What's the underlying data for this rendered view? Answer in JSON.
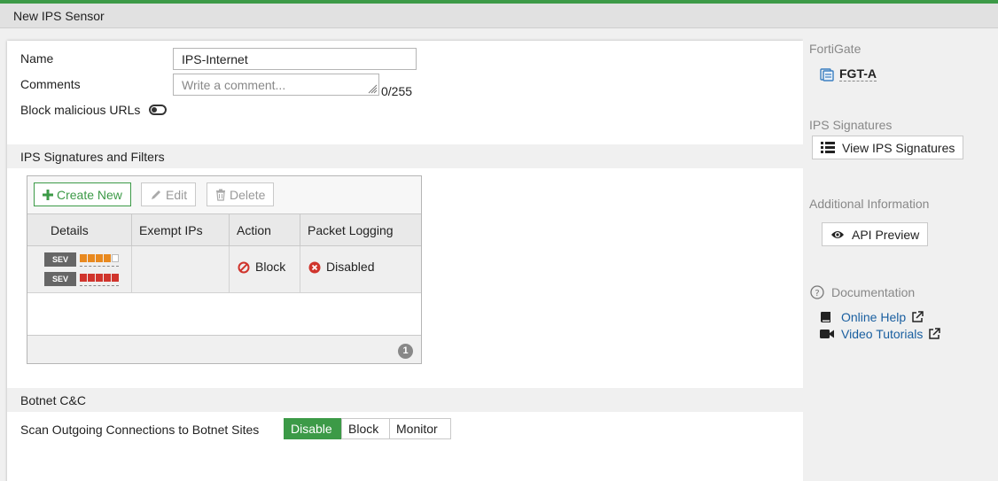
{
  "window": {
    "title": "New IPS Sensor"
  },
  "form": {
    "name_label": "Name",
    "name_value": "IPS-Internet",
    "comments_label": "Comments",
    "comments_placeholder": "Write a comment...",
    "comments_counter": "0/255",
    "block_urls_label": "Block malicious URLs"
  },
  "signatures": {
    "section_title": "IPS Signatures and Filters",
    "toolbar": {
      "create_label": "Create New",
      "edit_label": "Edit",
      "delete_label": "Delete"
    },
    "columns": [
      "Details",
      "Exempt IPs",
      "Action",
      "Packet Logging"
    ],
    "rows": [
      {
        "severity_badges": [
          "SEV",
          "SEV"
        ],
        "severity_levels": [
          4,
          5
        ],
        "exempt_ips": "",
        "action": "Block",
        "packet_logging": "Disabled"
      }
    ],
    "count": "1"
  },
  "botnet": {
    "section_title": "Botnet C&C",
    "scan_label": "Scan Outgoing Connections to Botnet Sites",
    "options": [
      "Disable",
      "Block",
      "Monitor"
    ],
    "selected": "Disable"
  },
  "sidebar": {
    "fortigate_heading": "FortiGate",
    "fortigate_device": "FGT-A",
    "ips_heading": "IPS Signatures",
    "view_signatures_label": "View IPS Signatures",
    "additional_heading": "Additional Information",
    "api_preview_label": "API Preview",
    "documentation_heading": "Documentation",
    "online_help_label": "Online Help",
    "video_tutorials_label": "Video Tutorials"
  },
  "colors": {
    "accent_green": "#3c9a47",
    "severity_orange": "#e8891f",
    "severity_red": "#d0342c",
    "link_blue": "#1a5fa0",
    "block_red": "#d0342c"
  }
}
